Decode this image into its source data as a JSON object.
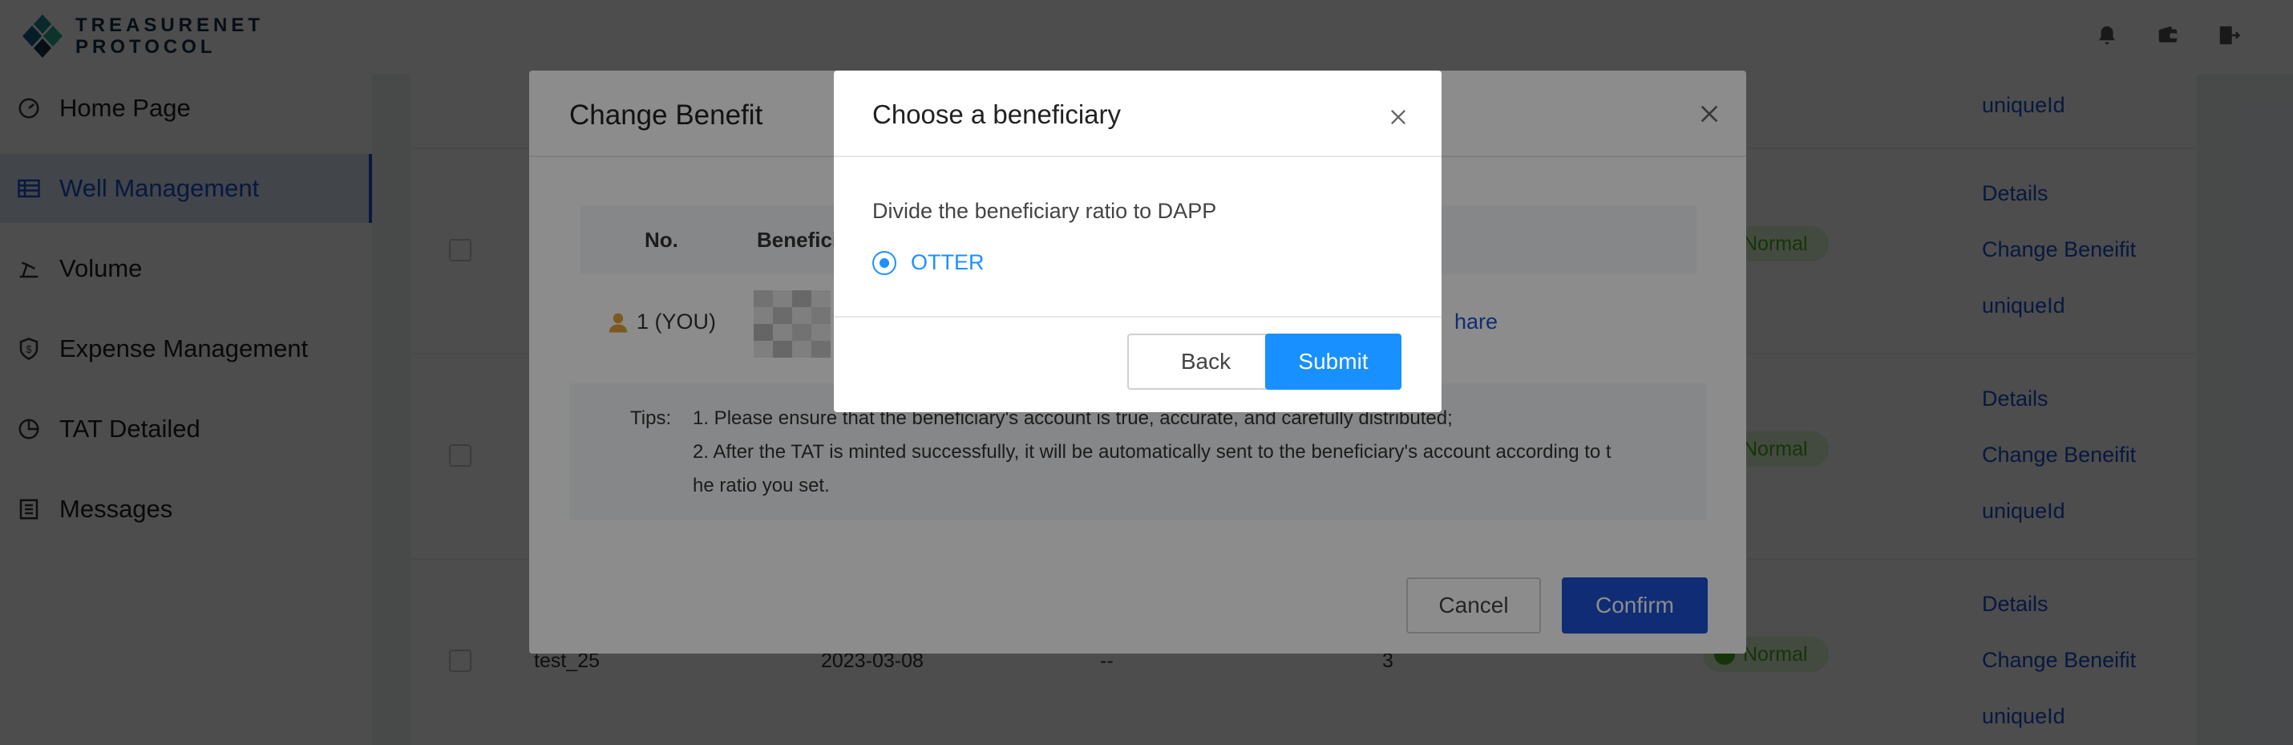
{
  "header": {
    "logo_line1": "TREASURENET",
    "logo_line2": "PROTOCOL",
    "icons": [
      "bell-icon",
      "wallet-icon",
      "logout-icon"
    ]
  },
  "sidebar": {
    "items": [
      {
        "label": "Home Page",
        "icon": "dashboard-icon"
      },
      {
        "label": "Well Management",
        "icon": "table-icon",
        "active": true
      },
      {
        "label": "Volume",
        "icon": "oil-pump-icon"
      },
      {
        "label": "Expense Management",
        "icon": "shield-dollar-icon"
      },
      {
        "label": "TAT Detailed",
        "icon": "pie-icon"
      },
      {
        "label": "Messages",
        "icon": "list-icon"
      }
    ]
  },
  "table": {
    "rows": [
      {
        "links": [
          "uniqueId"
        ]
      },
      {
        "status": "Normal",
        "links": [
          "Details",
          "Change Beneifit",
          "uniqueId"
        ]
      },
      {
        "status": "Normal",
        "links": [
          "Details",
          "Change Beneifit",
          "uniqueId"
        ]
      },
      {
        "name": "test_25",
        "date": "2023-03-08",
        "dash": "--",
        "count": "3",
        "status": "Normal",
        "links": [
          "Details",
          "Change Beneifit",
          "uniqueId"
        ]
      }
    ]
  },
  "change_benefit_dialog": {
    "title": "Change Benefit",
    "columns": [
      "No.",
      "Beneficia"
    ],
    "row_no": "1 (YOU)",
    "share_link": "hare",
    "tips_label": "Tips:",
    "tips": [
      "1. Please ensure that the beneficiary's account is true, accurate, and carefully distributed;",
      "2. After the TAT is minted successfully, it will be automatically sent to the beneficiary's account according to t",
      "he ratio you set."
    ],
    "cancel_label": "Cancel",
    "confirm_label": "Confirm"
  },
  "beneficiary_dialog": {
    "title": "Choose a beneficiary",
    "description": "Divide the beneficiary ratio to DAPP",
    "option": "OTTER",
    "option_selected": true,
    "back_label": "Back",
    "submit_label": "Submit"
  },
  "colors": {
    "brand_blue": "#1e50d4",
    "submit_blue": "#1890ff",
    "status_green": "#4cae22"
  }
}
